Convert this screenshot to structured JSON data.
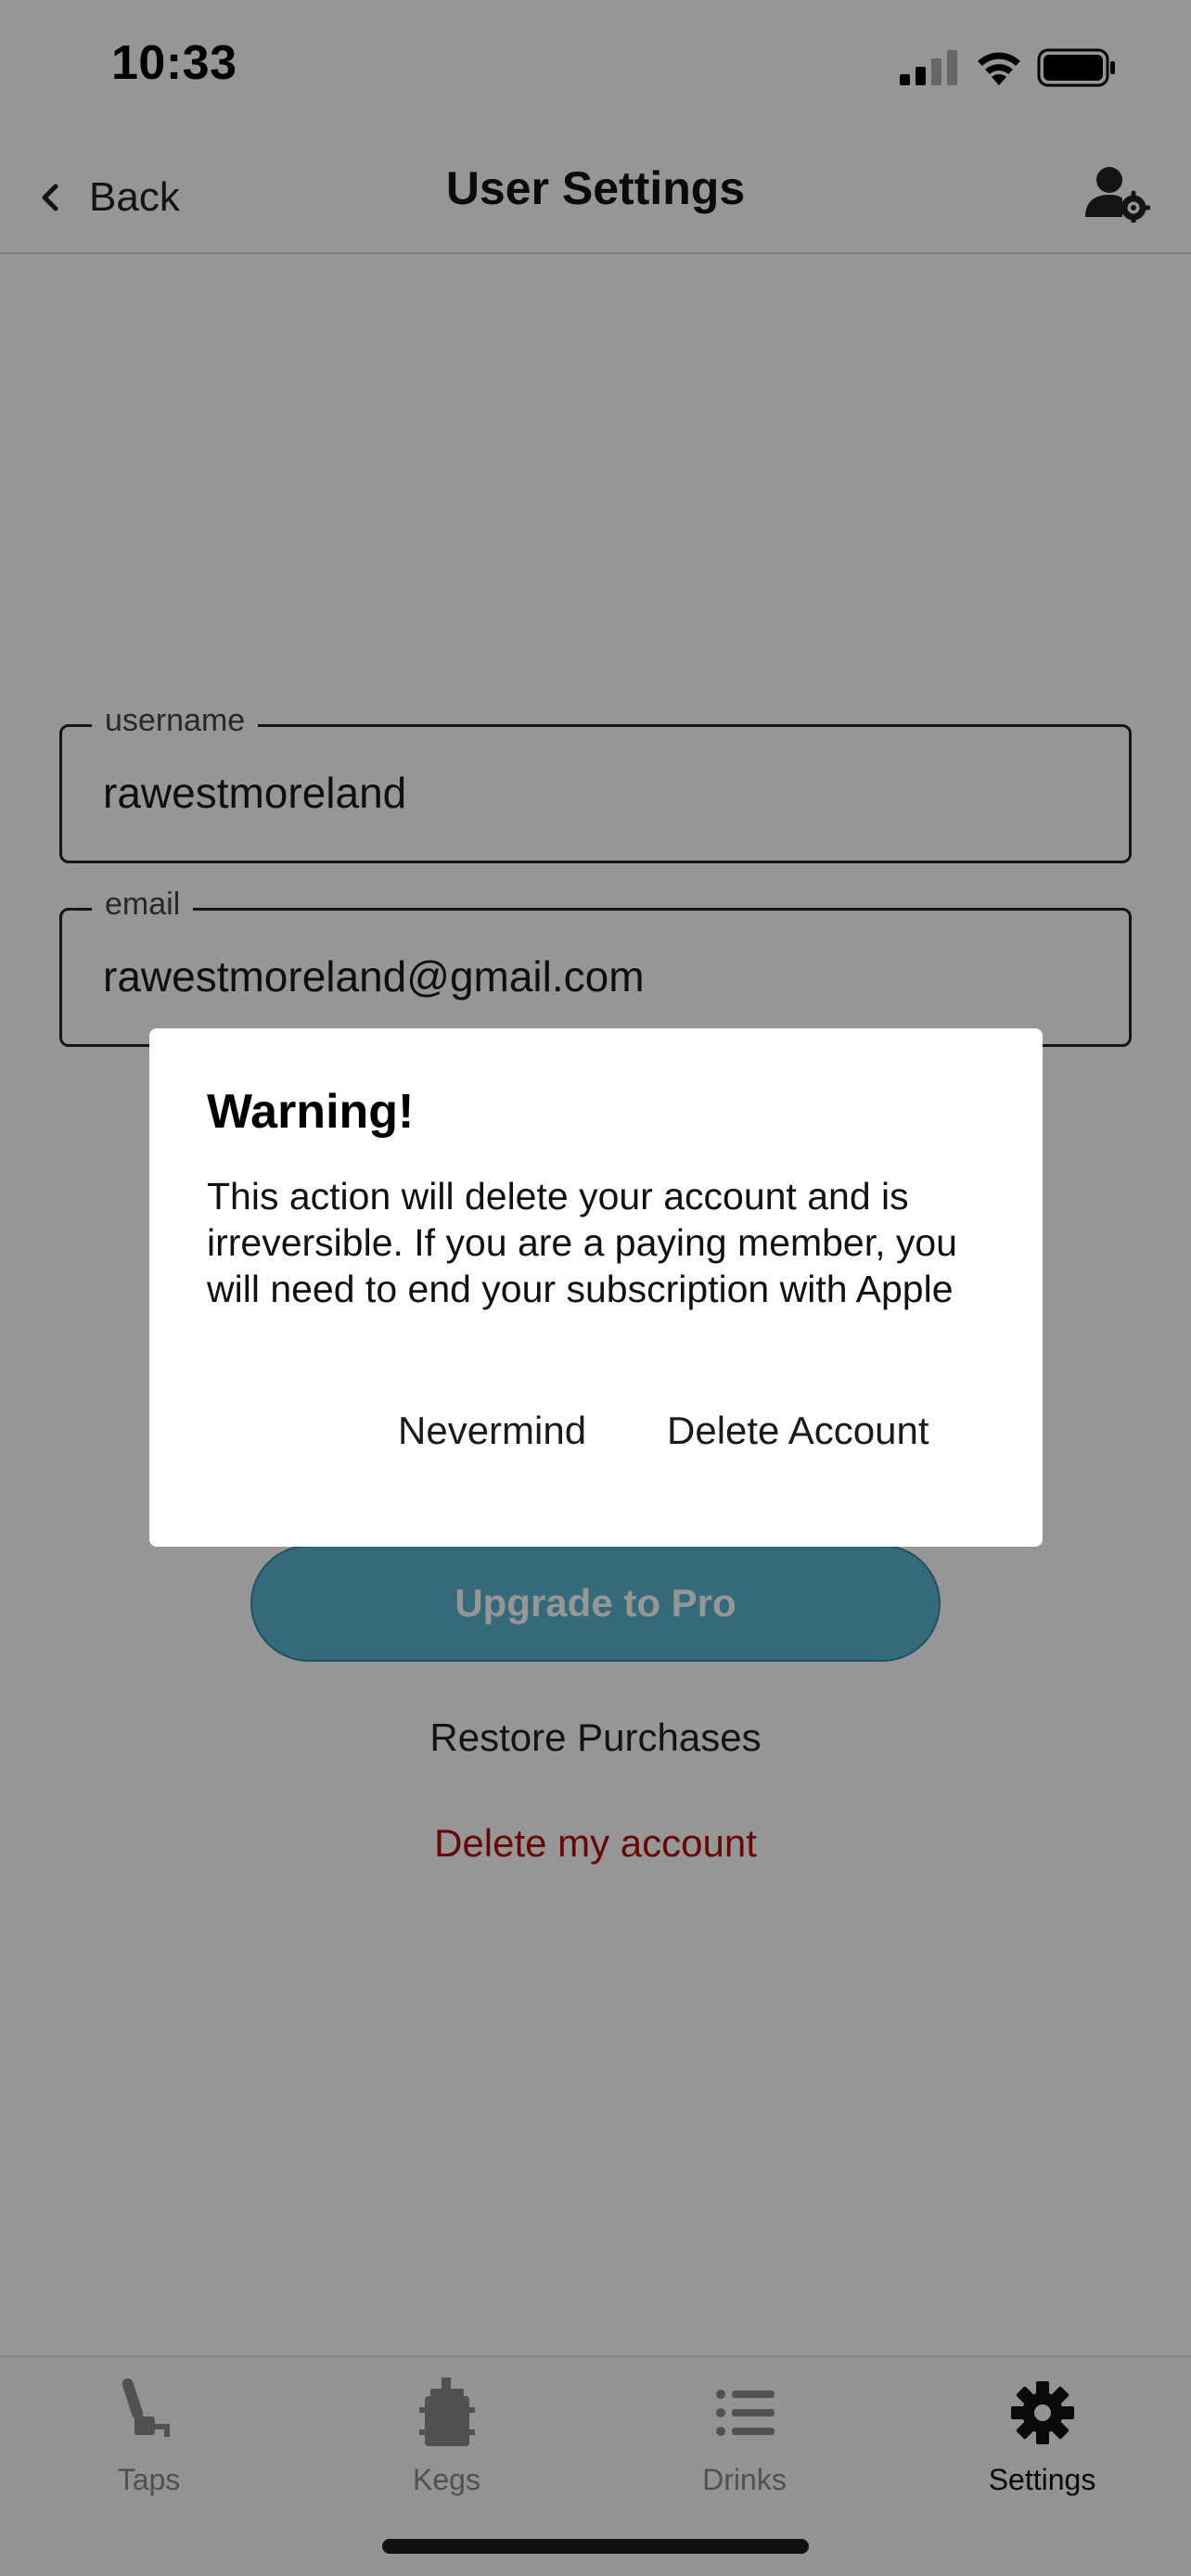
{
  "status_bar": {
    "time": "10:33",
    "signal_icon": "cellular-signal-icon",
    "wifi_icon": "wifi-icon",
    "battery_icon": "battery-icon"
  },
  "header": {
    "back_label": "Back",
    "title": "User Settings",
    "right_icon": "user-settings-icon"
  },
  "form": {
    "username": {
      "label": "username",
      "value": "rawestmoreland"
    },
    "email": {
      "label": "email",
      "value": "rawestmoreland@gmail.com"
    }
  },
  "actions": {
    "upgrade_label": "Upgrade to Pro",
    "restore_label": "Restore Purchases",
    "delete_label": "Delete my account"
  },
  "dialog": {
    "title": "Warning!",
    "body": "This action will delete your account and is irreversible. If you are a paying member, you will need to end your subscription with Apple",
    "cancel_label": "Nevermind",
    "confirm_label": "Delete Account"
  },
  "tab_bar": {
    "tabs": [
      {
        "label": "Taps",
        "icon": "tap-handle-icon",
        "active": false
      },
      {
        "label": "Kegs",
        "icon": "keg-icon",
        "active": false
      },
      {
        "label": "Drinks",
        "icon": "list-icon",
        "active": false
      },
      {
        "label": "Settings",
        "icon": "gear-icon",
        "active": true
      }
    ]
  },
  "colors": {
    "accent": "#5ab4cf",
    "danger": "#b00c0c",
    "overlay": "rgba(0,0,0,0.41)"
  }
}
